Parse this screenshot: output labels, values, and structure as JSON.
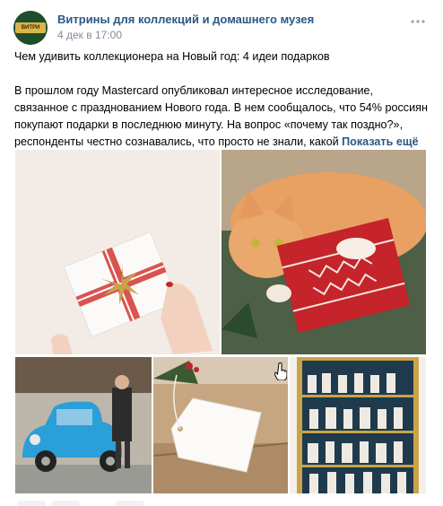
{
  "group": {
    "name": "Витрины для коллекций и домашнего музея",
    "date": "4 дек в 17:00",
    "avatar_text": "ВИТРИ"
  },
  "post": {
    "title": "Чем удивить коллекционера на Новый год: 4 идеи подарков",
    "body": "В прошлом году Mastercard опубликовал интересное исследование, связанное с празднованием Нового года. В нем сообщалось, что 54% россиян покупают подарки в последнюю минуту. На вопрос «почему так поздно?», респонденты честно сознавались, что просто не знали, какой",
    "show_more": "Показать ещё"
  },
  "photos": [
    {
      "subject": "gift-box-with-ribbon"
    },
    {
      "subject": "cat-with-red-gift"
    },
    {
      "subject": "blue-retro-car"
    },
    {
      "subject": "kraft-gift-with-tag"
    },
    {
      "subject": "figurine-display-cabinet"
    }
  ],
  "colors": {
    "link": "#2a5885",
    "secondary_text": "#818c99",
    "icon": "#99a2ad"
  },
  "icons": {
    "more": "more-horizontal-icon",
    "cursor": "hand-pointer-cursor"
  }
}
